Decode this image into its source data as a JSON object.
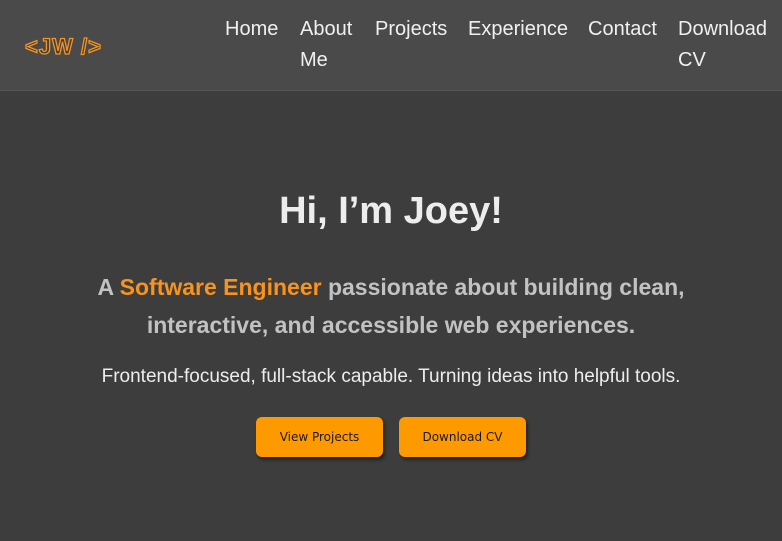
{
  "navbar": {
    "logo": "<JW />",
    "links": {
      "home": "Home",
      "about_line1": "About",
      "about_line2": "Me",
      "projects": "Projects",
      "experience": "Experience",
      "contact": "Contact",
      "download_line1": "Download",
      "download_line2": "CV"
    }
  },
  "hero": {
    "title": "Hi, I’m Joey!",
    "subtitle_prefix": "A ",
    "subtitle_highlight": "Software Engineer",
    "subtitle_suffix": " passionate about building clean, interactive, and accessible web experiences.",
    "tagline": "Frontend-focused, full-stack capable. Turning ideas into helpful tools.",
    "buttons": {
      "view_projects": "View Projects",
      "download_cv": "Download CV"
    }
  },
  "colors": {
    "accent": "#f7931e",
    "button": "#ff9900",
    "background": "#3d3d3d",
    "navbar": "#4a4a4a"
  }
}
